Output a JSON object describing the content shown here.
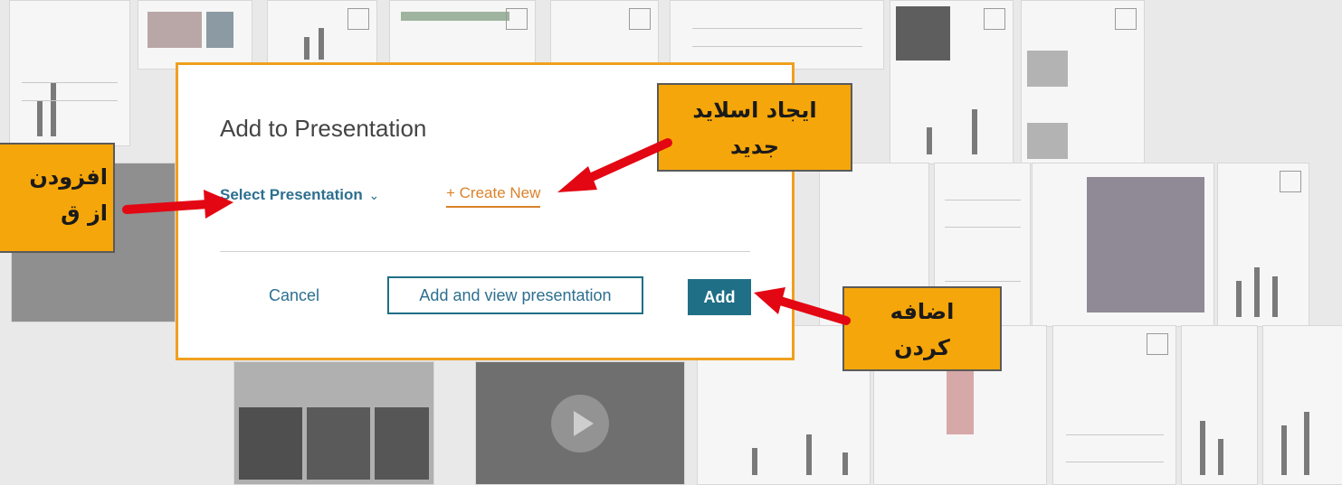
{
  "dialog": {
    "title": "Add to Presentation",
    "select_presentation": "Select Presentation",
    "create_new": "+ Create New",
    "cancel": "Cancel",
    "add_and_view": "Add and view presentation",
    "add": "Add"
  },
  "callouts": {
    "create_slide": [
      "ایجاد اسلاید",
      "جدید"
    ],
    "add_from_existing": [
      "افزودن ",
      "از ق"
    ],
    "add_button": [
      "اضافه",
      "کردن"
    ]
  },
  "colors": {
    "accent_orange": "#f0a01e",
    "callout_fill": "#f5a60a",
    "primary_teal": "#1f6f86",
    "link_orange": "#d9822b",
    "arrow_red": "#e30613"
  },
  "icons": {
    "dropdown": "chevron-down-icon",
    "play": "play-icon",
    "arrow": "red-arrow-icon"
  }
}
